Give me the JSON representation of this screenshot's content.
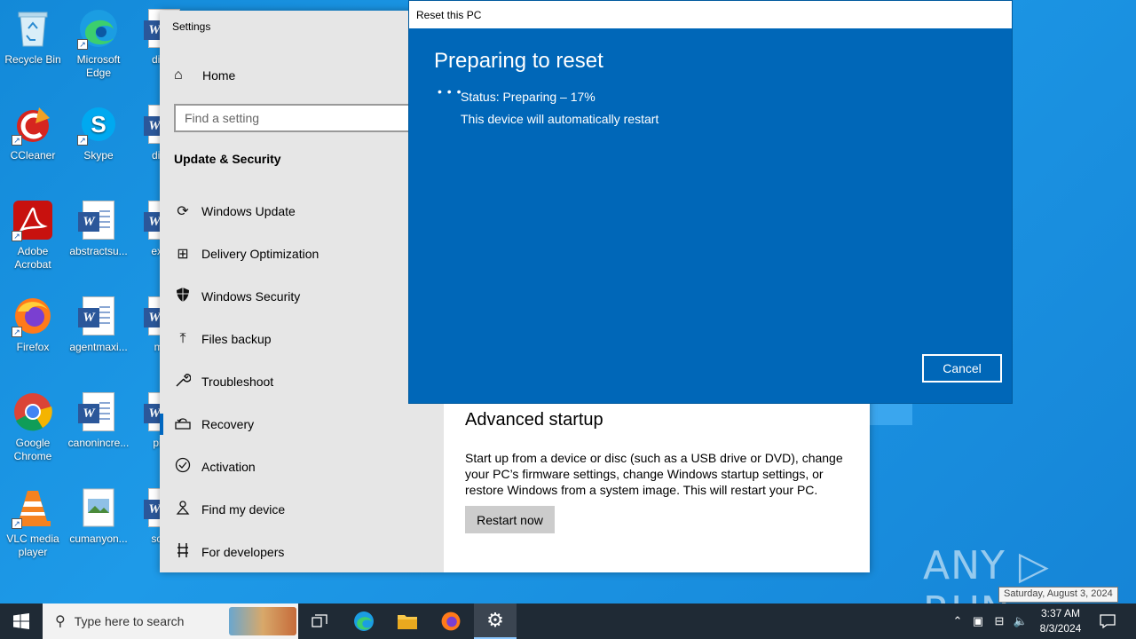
{
  "desktop": {
    "icons": [
      {
        "label": "Recycle Bin",
        "icon": "recycle-bin-icon"
      },
      {
        "label": "Microsoft Edge",
        "icon": "edge-icon"
      },
      {
        "label": "dictio",
        "icon": "word-document-icon"
      },
      {
        "label": "CCleaner",
        "icon": "ccleaner-icon"
      },
      {
        "label": "Skype",
        "icon": "skype-icon"
      },
      {
        "label": "discu",
        "icon": "word-document-icon"
      },
      {
        "label": "Adobe Acrobat",
        "icon": "acrobat-icon"
      },
      {
        "label": "abstractsu...",
        "icon": "word-document-icon"
      },
      {
        "label": "exam",
        "icon": "word-document-icon"
      },
      {
        "label": "Firefox",
        "icon": "firefox-icon"
      },
      {
        "label": "agentmaxi...",
        "icon": "word-document-icon"
      },
      {
        "label": "mac",
        "icon": "word-document-icon"
      },
      {
        "label": "Google Chrome",
        "icon": "chrome-icon"
      },
      {
        "label": "canonincre...",
        "icon": "word-document-icon"
      },
      {
        "label": "pictu",
        "icon": "word-document-icon"
      },
      {
        "label": "VLC media player",
        "icon": "vlc-icon"
      },
      {
        "label": "cumanyon...",
        "icon": "image-file-icon"
      },
      {
        "label": "south",
        "icon": "word-document-icon"
      }
    ]
  },
  "settings": {
    "window_title": "Settings",
    "home_label": "Home",
    "search_placeholder": "Find a setting",
    "section_title": "Update & Security",
    "nav_items": [
      {
        "label": "Windows Update",
        "icon": "sync-icon"
      },
      {
        "label": "Delivery Optimization",
        "icon": "delivery-optimization-icon"
      },
      {
        "label": "Windows Security",
        "icon": "shield-icon"
      },
      {
        "label": "Files backup",
        "icon": "upload-arrow-icon"
      },
      {
        "label": "Troubleshoot",
        "icon": "wrench-icon"
      },
      {
        "label": "Recovery",
        "icon": "recovery-icon"
      },
      {
        "label": "Activation",
        "icon": "checkmark-circle-icon"
      },
      {
        "label": "Find my device",
        "icon": "person-location-icon"
      },
      {
        "label": "For developers",
        "icon": "developer-tools-icon"
      }
    ],
    "active_item": "Recovery",
    "advanced_startup": {
      "title": "Advanced startup",
      "description": "Start up from a device or disc (such as a USB drive or DVD), change your PC’s firmware settings, change Windows startup settings, or restore Windows from a system image. This will restart your PC.",
      "button_label": "Restart now"
    }
  },
  "reset_dialog": {
    "window_title": "Reset this PC",
    "heading": "Preparing to reset",
    "status": "Status: Preparing – 17%",
    "note": "This device will automatically restart",
    "cancel_label": "Cancel"
  },
  "watermark": "ANY ▷ RUN",
  "tooltip": "Saturday, August 3, 2024",
  "taskbar": {
    "search_placeholder": "Type here to search",
    "clock_time": "3:37 AM",
    "clock_date": "8/3/2024"
  },
  "colors": {
    "desktop_blue": "#1389d8",
    "dialog_blue": "#0067b8",
    "accent": "#0067c0",
    "taskbar": "#1f2a35"
  }
}
